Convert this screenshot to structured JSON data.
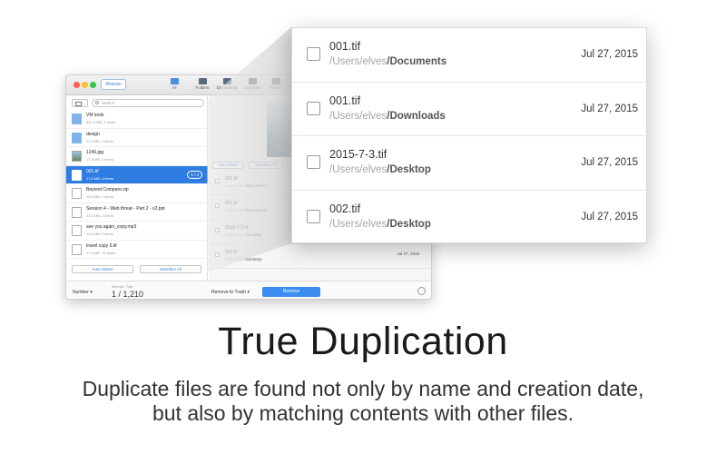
{
  "toolbar": {
    "rescan": "Rescan",
    "tools": [
      {
        "label": "All",
        "icon": "box-icon"
      },
      {
        "label": "Folders",
        "icon": "folder-icon"
      },
      {
        "label": "Documents",
        "icon": "document-icon"
      },
      {
        "label": "Archives",
        "icon": "archive-icon"
      },
      {
        "label": "Photos",
        "icon": "photo-icon"
      }
    ]
  },
  "search": {
    "placeholder": "Search"
  },
  "files": [
    {
      "name": "VM tools",
      "meta": "867.9 MB, 2 items",
      "icon": "folder-icon"
    },
    {
      "name": "design",
      "meta": "23.3 MB, 2 items",
      "icon": "folder-icon"
    },
    {
      "name": "1246.jpg",
      "meta": "17.8 MB, 2 items",
      "icon": "image-icon"
    },
    {
      "name": "001.tif",
      "meta": "17.8 MB, 4 items",
      "icon": "file-icon",
      "badge": "1 / 4",
      "selected": true
    },
    {
      "name": "Beyond Compare.zip",
      "meta": "16.5 MB, 2 items",
      "icon": "zip-icon"
    },
    {
      "name": "Session 4 - Web threat - Part 2 - v2.ppt",
      "meta": "13.0 MB, 2 items",
      "icon": "ppt-icon"
    },
    {
      "name": "see you again_copy.mp3",
      "meta": "12.6 MB, 2 items",
      "icon": "audio-icon"
    },
    {
      "name": "travel copy 6.tif",
      "meta": "17.5 MB, 15 items",
      "icon": "file-icon"
    }
  ],
  "sidebar_buttons": {
    "auto_select": "Auto Select",
    "deselect_all": "Deselect All"
  },
  "detail_buttons": {
    "auto_select": "Auto Select",
    "deselect_all": "Deselect All"
  },
  "duplicates": [
    {
      "name": "001.tif",
      "path_prefix": "/Users/elves",
      "path_folder": "/Documents",
      "date": "Jul 27, 2015"
    },
    {
      "name": "001.tif",
      "path_prefix": "/Users/elves",
      "path_folder": "/Downloads",
      "date": "Jul 27, 2015"
    },
    {
      "name": "2015-7-3.tif",
      "path_prefix": "/Users/elves",
      "path_folder": "/Desktop",
      "date": "Jul 27, 2015"
    },
    {
      "name": "002.tif",
      "path_prefix": "/Users/elves",
      "path_folder": "/Desktop",
      "date": "Jul 27, 2015"
    }
  ],
  "bottom": {
    "sort": "Number",
    "selected_label": "Selected",
    "total_label": "Total",
    "count": "1 / 1,210",
    "action": "Remove to Trash",
    "remove": "Remove"
  },
  "caption": {
    "title": "True Duplication",
    "line1": "Duplicate files are found not only by name and creation date,",
    "line2": "but also by matching contents with other files."
  },
  "colors": {
    "accent": "#2f7de1",
    "remove_button": "#3b8ef0",
    "close": "#fc5f57",
    "minimize": "#fdbc2e",
    "zoom": "#33c748"
  }
}
